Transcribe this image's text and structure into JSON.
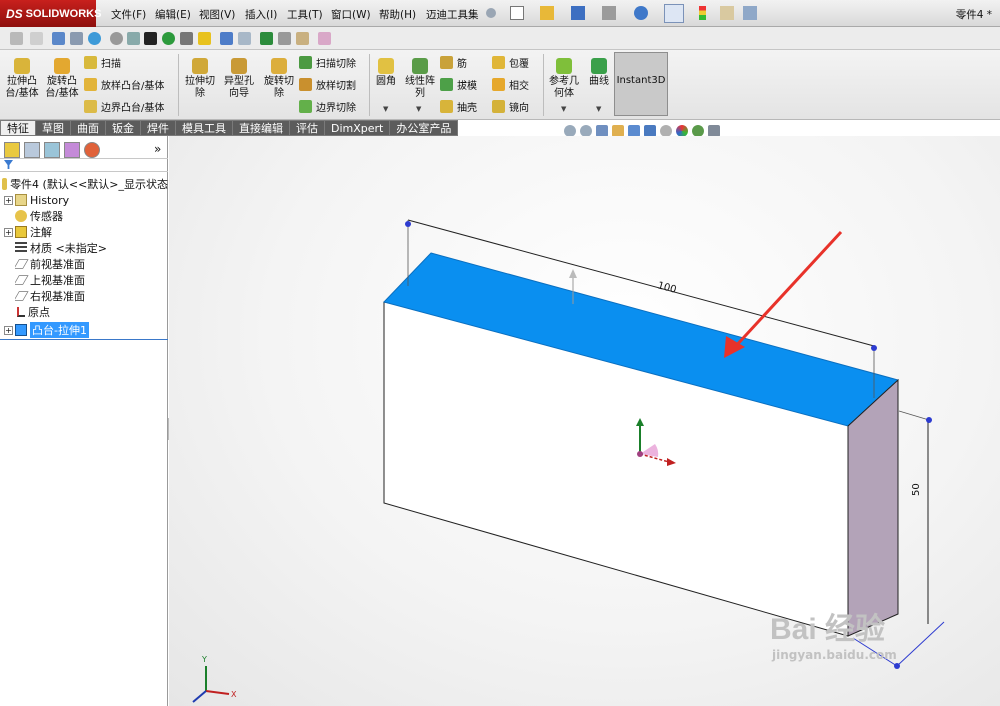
{
  "app": {
    "logo_prefix": "DS",
    "logo_text": "SOLIDWORKS",
    "doc_title": "零件4 *"
  },
  "menu": [
    "文件(F)",
    "编辑(E)",
    "视图(V)",
    "插入(I)",
    "工具(T)",
    "窗口(W)",
    "帮助(H)",
    "迈迪工具集"
  ],
  "ribbon": {
    "extrude_boss": "拉伸凸台/基体",
    "revolve_boss": "旋转凸台/基体",
    "sweep": "扫描",
    "loft_boss": "放样凸台/基体",
    "boundary_boss": "边界凸台/基体",
    "extrude_cut": "拉伸切除",
    "hole_wizard": "异型孔向导",
    "revolve_cut": "旋转切除",
    "sweep_cut": "扫描切除",
    "loft_cut": "放样切割",
    "boundary_cut": "边界切除",
    "fillet": "圆角",
    "linear_pattern": "线性阵列",
    "rib": "筋",
    "draft": "拔模",
    "shell": "抽壳",
    "wrap": "包覆",
    "intersect": "相交",
    "mirror": "镜向",
    "ref_geometry": "参考几何体",
    "curves": "曲线",
    "instant3d": "Instant3D"
  },
  "tabs": [
    "特征",
    "草图",
    "曲面",
    "钣金",
    "焊件",
    "模具工具",
    "直接编辑",
    "评估",
    "DimXpert",
    "办公室产品"
  ],
  "panel": {
    "collapse_label": "»"
  },
  "tree": {
    "root": "零件4 (默认<<默认>_显示状态",
    "history": "History",
    "sensors": "传感器",
    "annotations": "注解",
    "material": "材质 <未指定>",
    "front_plane": "前视基准面",
    "top_plane": "上视基准面",
    "right_plane": "右视基准面",
    "origin": "原点",
    "boss_extrude": "凸台-拉伸1"
  },
  "dimensions": {
    "length": "100",
    "height": "50"
  },
  "watermark": {
    "brand": "Bai 经验",
    "url": "jingyan.baidu.com"
  },
  "colors": {
    "face_highlight": "#0a8ff0",
    "arrow": "#e8322a",
    "side_face": "#b3a3b8",
    "app_red": "#c8201d"
  }
}
